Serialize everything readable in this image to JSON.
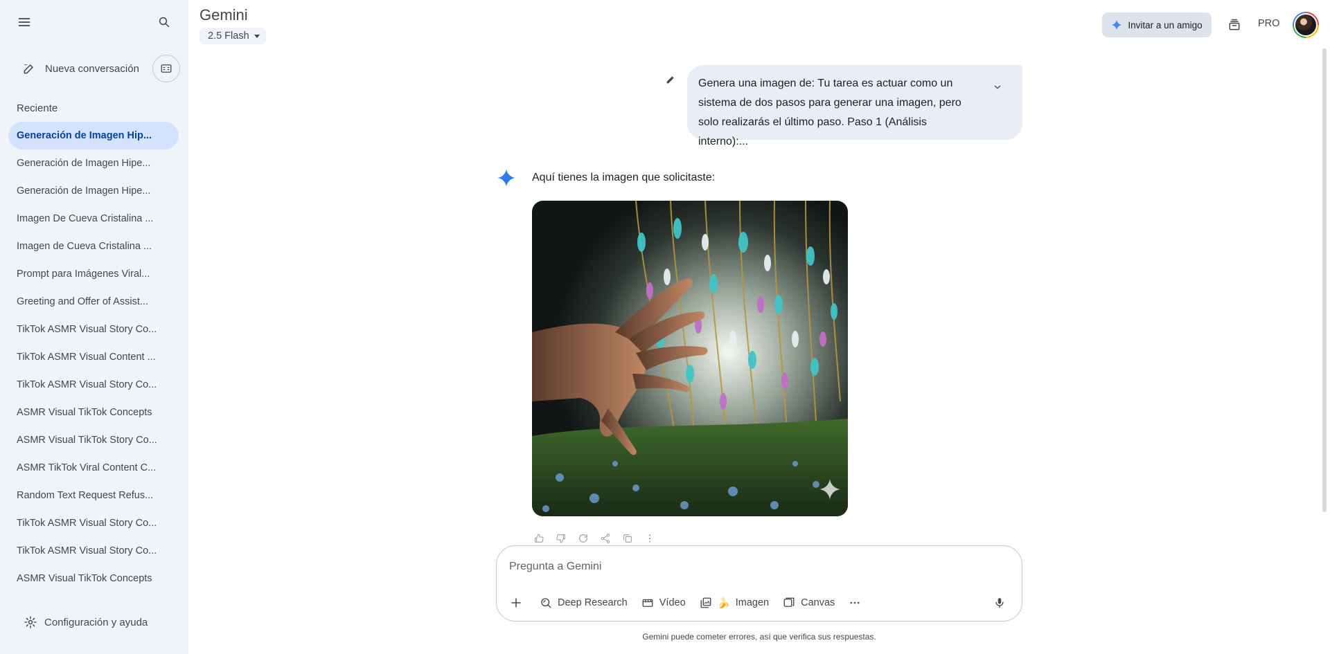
{
  "header": {
    "app_title": "Gemini",
    "model": "2.5 Flash",
    "invite_label": "Invitar a un amigo",
    "pro_label": "PRO"
  },
  "sidebar": {
    "new_chat_label": "Nueva conversación",
    "recent_title": "Reciente",
    "items": [
      {
        "label": "Generación de Imagen Hip..."
      },
      {
        "label": "Generación de Imagen Hipe..."
      },
      {
        "label": "Generación de Imagen Hipe..."
      },
      {
        "label": "Imagen De Cueva Cristalina ..."
      },
      {
        "label": "Imagen de Cueva Cristalina ..."
      },
      {
        "label": "Prompt para Imágenes Viral..."
      },
      {
        "label": "Greeting and Offer of Assist..."
      },
      {
        "label": "TikTok ASMR Visual Story Co..."
      },
      {
        "label": "TikTok ASMR Visual Content ..."
      },
      {
        "label": "TikTok ASMR Visual Story Co..."
      },
      {
        "label": "ASMR Visual TikTok Concepts"
      },
      {
        "label": "ASMR Visual TikTok Story Co..."
      },
      {
        "label": "ASMR TikTok Viral Content C..."
      },
      {
        "label": "Random Text Request Refus..."
      },
      {
        "label": "TikTok ASMR Visual Story Co..."
      },
      {
        "label": "TikTok ASMR Visual Story Co..."
      },
      {
        "label": "ASMR Visual TikTok Concepts"
      }
    ],
    "settings_label": "Configuración y ayuda"
  },
  "conversation": {
    "user_message": "Genera una imagen de: Tu tarea es actuar como un sistema de dos pasos para generar una imagen, pero solo realizarás el último paso. Paso 1 (Análisis interno):...",
    "response_text": "Aquí tienes la imagen que solicitaste:"
  },
  "composer": {
    "placeholder": "Pregunta a Gemini",
    "tools": {
      "deep_research": "Deep Research",
      "video": "Vídeo",
      "image_emoji": "🍌",
      "image": "Imagen",
      "canvas": "Canvas"
    },
    "disclaimer": "Gemini puede cometer errores, así que verifica sus respuestas."
  },
  "colors": {
    "sidebar_bg": "#f0f4f9",
    "active_item_bg": "#d3e3fd",
    "active_item_text": "#0842a0",
    "accent_blue": "#4285f4"
  },
  "icons": [
    "menu-icon",
    "search-icon",
    "edit-icon",
    "gem-icon",
    "settings-icon",
    "spark-icon",
    "pencil-icon",
    "chevron-down-icon",
    "thumbs-up-icon",
    "thumbs-down-icon",
    "refresh-icon",
    "share-icon",
    "copy-icon",
    "more-vert-icon",
    "plus-icon",
    "deep-research-icon",
    "video-icon",
    "image-icon",
    "canvas-icon",
    "more-horiz-icon",
    "mic-icon",
    "history-icon"
  ]
}
